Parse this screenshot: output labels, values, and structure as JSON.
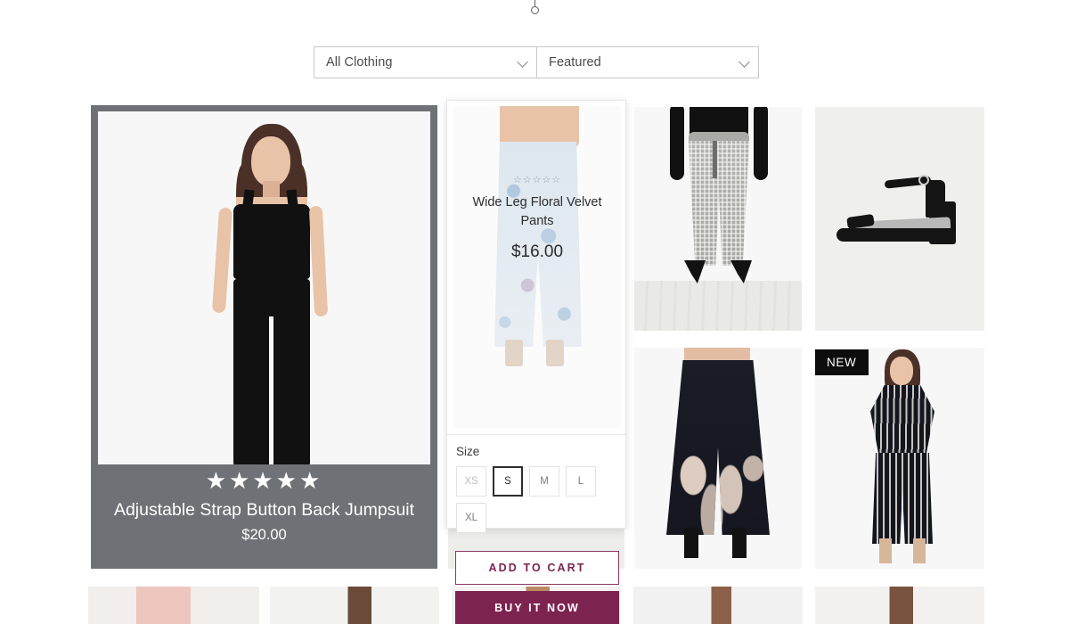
{
  "filters": {
    "category": {
      "value": "All Clothing",
      "icon": "chevron-down-icon"
    },
    "sort": {
      "value": "Featured",
      "icon": "chevron-down-icon"
    }
  },
  "featured_product": {
    "title": "Adjustable Strap Button Back Jumpsuit",
    "price": "$20.00",
    "rating_stars": "★★★★★",
    "rating_value": 5
  },
  "quickview": {
    "rating_stars": "☆☆☆☆☆",
    "rating_value": 0,
    "title": "Wide Leg Floral Velvet Pants",
    "price": "$16.00",
    "size_label": "Size",
    "sizes": [
      {
        "label": "XS",
        "state": "unavailable"
      },
      {
        "label": "S",
        "state": "selected"
      },
      {
        "label": "M",
        "state": "available"
      },
      {
        "label": "L",
        "state": "available"
      },
      {
        "label": "XL",
        "state": "available"
      }
    ],
    "add_to_cart_label": "ADD TO CART",
    "buy_now_label": "BUY IT NOW",
    "accent_color": "#7d2350"
  },
  "tiles": {
    "badge_new": "NEW"
  }
}
